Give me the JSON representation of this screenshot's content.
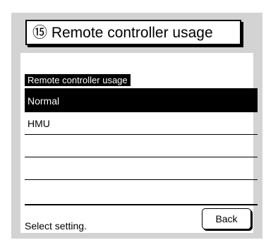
{
  "header": {
    "title": "⑮ Remote controller usage"
  },
  "section": {
    "label": "Remote controller usage"
  },
  "options": [
    {
      "label": "Normal",
      "selected": true
    },
    {
      "label": "HMU",
      "selected": false
    },
    {
      "label": "",
      "selected": false
    },
    {
      "label": "",
      "selected": false
    },
    {
      "label": "",
      "selected": false
    }
  ],
  "footer": {
    "status": "Select setting.",
    "back_label": "Back"
  },
  "colors": {
    "panel": "#d3d3d3",
    "selected_bg": "#000000",
    "selected_fg": "#ffffff"
  }
}
